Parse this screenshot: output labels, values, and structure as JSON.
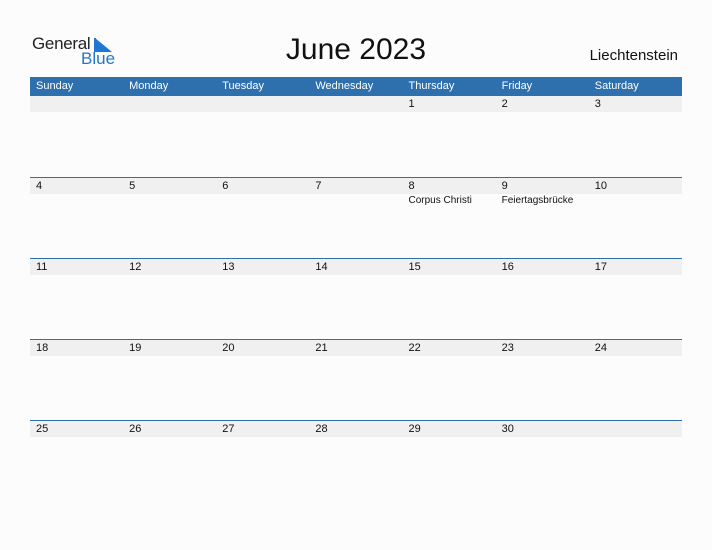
{
  "logo": {
    "general": "General",
    "blue": "Blue",
    "brand_color": "#1f77d0"
  },
  "title": "June 2023",
  "country": "Liechtenstein",
  "header_color": "#2e6fad",
  "weekdays": [
    "Sunday",
    "Monday",
    "Tuesday",
    "Wednesday",
    "Thursday",
    "Friday",
    "Saturday"
  ],
  "weeks": [
    {
      "days": [
        "",
        "",
        "",
        "",
        "1",
        "2",
        "3"
      ],
      "notes": [
        "",
        "",
        "",
        "",
        "",
        "",
        ""
      ]
    },
    {
      "days": [
        "4",
        "5",
        "6",
        "7",
        "8",
        "9",
        "10"
      ],
      "notes": [
        "",
        "",
        "",
        "",
        "Corpus Christi",
        "Feiertagsbrücke",
        ""
      ]
    },
    {
      "days": [
        "11",
        "12",
        "13",
        "14",
        "15",
        "16",
        "17"
      ],
      "notes": [
        "",
        "",
        "",
        "",
        "",
        "",
        ""
      ]
    },
    {
      "days": [
        "18",
        "19",
        "20",
        "21",
        "22",
        "23",
        "24"
      ],
      "notes": [
        "",
        "",
        "",
        "",
        "",
        "",
        ""
      ]
    },
    {
      "days": [
        "25",
        "26",
        "27",
        "28",
        "29",
        "30",
        ""
      ],
      "notes": [
        "",
        "",
        "",
        "",
        "",
        "",
        ""
      ]
    }
  ]
}
